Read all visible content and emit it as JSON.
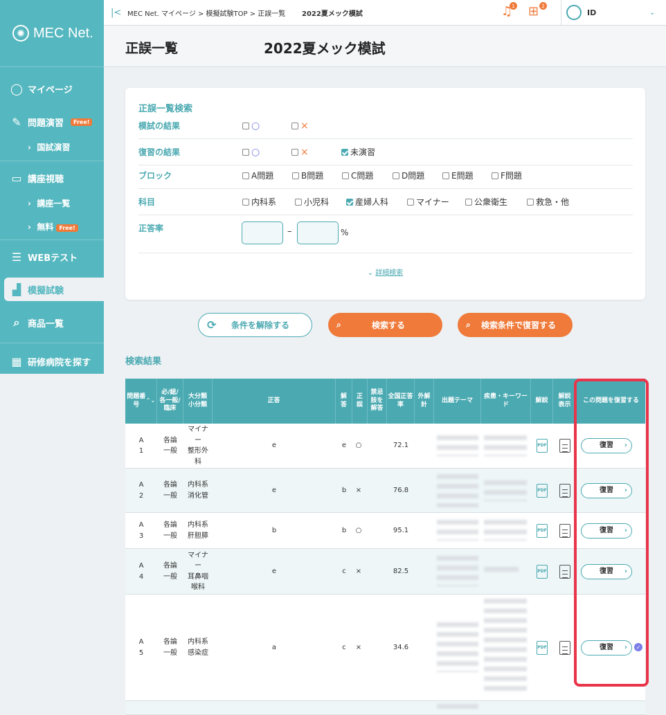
{
  "brand": {
    "logo_text": "MEC Net.",
    "logo_icon": "atom-icon"
  },
  "sidebar": {
    "items": [
      {
        "label": "マイページ",
        "icon": "user-circle-icon"
      },
      {
        "label": "問題演習",
        "icon": "pencil-note-icon",
        "badge": "Free!"
      },
      {
        "label": "国試演習",
        "sub": true
      },
      {
        "label": "講座視聴",
        "icon": "video-icon"
      },
      {
        "label": "講座一覧",
        "sub": true
      },
      {
        "label": "無料",
        "sub": true,
        "badge": "Free!"
      },
      {
        "label": "WEBテスト",
        "icon": "checklist-icon"
      },
      {
        "label": "模擬試験",
        "icon": "bar-chart-icon",
        "selected": true
      },
      {
        "label": "商品一覧",
        "icon": "search-list-icon"
      },
      {
        "label": "研修病院を探す",
        "icon": "hospital-icon"
      }
    ]
  },
  "topbar": {
    "breadcrumb": "MEC Net. マイページ > 模擬試験TOP > 正誤一覧",
    "exam": "2022夏メック模試",
    "bell_count": "1",
    "cart_count": "2",
    "user": "ID"
  },
  "page": {
    "title": "正誤一覧",
    "exam_title": "2022夏メック模試"
  },
  "search": {
    "heading": "正誤一覧検索",
    "rows": [
      {
        "label": "模試の結果"
      },
      {
        "label": "復習の結果",
        "unpracticed": "未演習"
      },
      {
        "label": "ブロック",
        "options": [
          "A問題",
          "B問題",
          "C問題",
          "D問題",
          "E問題",
          "F問題"
        ]
      },
      {
        "label": "科目",
        "options": [
          "内科系",
          "小児科",
          "産婦人科",
          "マイナー",
          "公衆衛生",
          "救急・他"
        ]
      },
      {
        "label": "正答率",
        "dash": "–",
        "unit": "%"
      }
    ],
    "detail_link": "詳細検索"
  },
  "buttons": {
    "reset": "条件を解除する",
    "search": "検索する",
    "review": "検索条件で復習する"
  },
  "results": {
    "heading": "検索結果",
    "headers": [
      "問題番号",
      "必/総/各一般/臨床",
      "大分類小分類",
      "正答",
      "解答",
      "正誤",
      "禁忌肢を解答",
      "全国正答率",
      "外解計",
      "出題テーマ",
      "疾患・キーワード",
      "解説",
      "解説表示",
      "この問題を復習する"
    ],
    "rows": [
      {
        "no": "A\n1",
        "type": "各論\n一般",
        "cat": "マイナ\nー\n整形外\n科",
        "correct": "e",
        "answer": "e",
        "result": "○",
        "rate": "72.1",
        "review": "復習"
      },
      {
        "no": "A\n2",
        "type": "各論\n一般",
        "cat": "内科系\n消化管",
        "correct": "e",
        "answer": "b",
        "result": "×",
        "rate": "76.8",
        "review": "復習"
      },
      {
        "no": "A\n3",
        "type": "各論\n一般",
        "cat": "内科系\n肝胆膵",
        "correct": "b",
        "answer": "b",
        "result": "○",
        "rate": "95.1",
        "review": "復習"
      },
      {
        "no": "A\n4",
        "type": "各論\n一般",
        "cat": "マイナ\nー\n耳鼻咽\n喉科",
        "correct": "e",
        "answer": "c",
        "result": "×",
        "rate": "82.5",
        "review": "復習"
      },
      {
        "no": "A\n5",
        "type": "各論\n一般",
        "cat": "内科系\n感染症",
        "correct": "a",
        "answer": "c",
        "result": "×",
        "rate": "34.6",
        "review": "復習"
      }
    ]
  },
  "colors": {
    "teal": "#55b7bf",
    "orange": "#ef7a3a",
    "red_highlight": "#e8354a"
  }
}
